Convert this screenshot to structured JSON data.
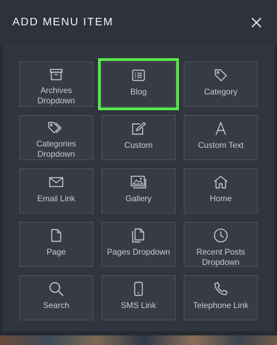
{
  "modal": {
    "title": "ADD MENU ITEM",
    "close_icon": "close-icon"
  },
  "items": [
    {
      "label": "Archives\nDropdown",
      "icon": "archive-box-icon"
    },
    {
      "label": "Blog",
      "icon": "list-document-icon",
      "selected": true
    },
    {
      "label": "Category",
      "icon": "tag-icon"
    },
    {
      "label": "Categories\nDropdown",
      "icon": "tags-icon"
    },
    {
      "label": "Custom",
      "icon": "edit-square-icon"
    },
    {
      "label": "Custom Text",
      "icon": "letter-a-icon"
    },
    {
      "label": "Email Link",
      "icon": "envelope-icon"
    },
    {
      "label": "Gallery",
      "icon": "images-icon"
    },
    {
      "label": "Home",
      "icon": "home-icon"
    },
    {
      "label": "Page",
      "icon": "file-icon"
    },
    {
      "label": "Pages Dropdown",
      "icon": "files-icon"
    },
    {
      "label": "Recent Posts\nDropdown",
      "icon": "clock-icon"
    },
    {
      "label": "Search",
      "icon": "search-icon"
    },
    {
      "label": "SMS Link",
      "icon": "mobile-phone-icon"
    },
    {
      "label": "Telephone Link",
      "icon": "telephone-icon"
    }
  ],
  "colors": {
    "highlight": "#58e84a",
    "tile_background": "#363b44",
    "panel_background": "#30353e"
  }
}
